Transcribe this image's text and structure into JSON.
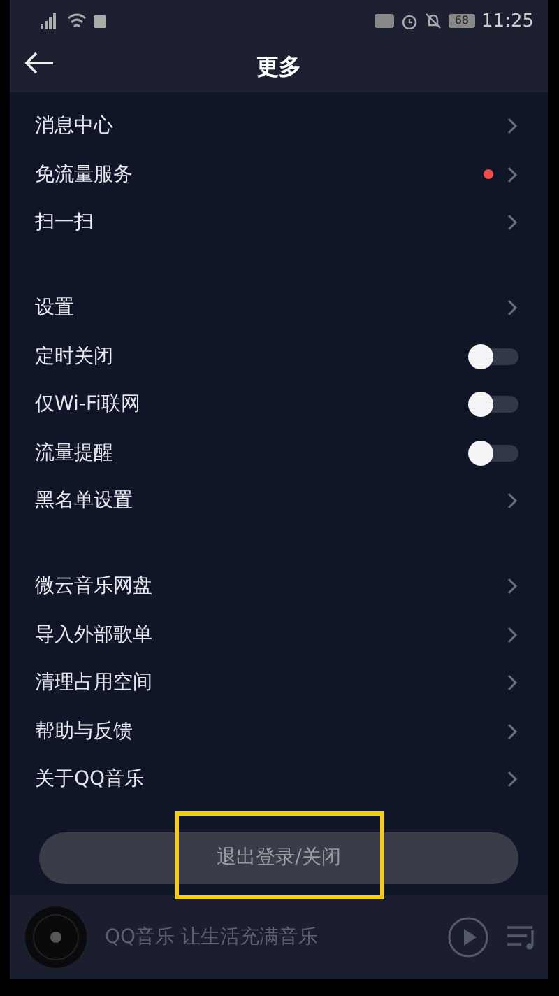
{
  "status_bar": {
    "battery": "68",
    "time": "11:25"
  },
  "header": {
    "title": "更多"
  },
  "groups": [
    {
      "items": [
        {
          "label": "消息中心",
          "kind": "link",
          "badge": false
        },
        {
          "label": "免流量服务",
          "kind": "link",
          "badge": true
        },
        {
          "label": "扫一扫",
          "kind": "link",
          "badge": false
        }
      ]
    },
    {
      "items": [
        {
          "label": "设置",
          "kind": "link",
          "badge": false
        },
        {
          "label": "定时关闭",
          "kind": "toggle",
          "on": false
        },
        {
          "label": "仅Wi-Fi联网",
          "kind": "toggle",
          "on": false
        },
        {
          "label": "流量提醒",
          "kind": "toggle",
          "on": false
        },
        {
          "label": "黑名单设置",
          "kind": "link",
          "badge": false
        }
      ]
    },
    {
      "items": [
        {
          "label": "微云音乐网盘",
          "kind": "link",
          "badge": false
        },
        {
          "label": "导入外部歌单",
          "kind": "link",
          "badge": false
        },
        {
          "label": "清理占用空间",
          "kind": "link",
          "badge": false
        },
        {
          "label": "帮助与反馈",
          "kind": "link",
          "badge": false
        },
        {
          "label": "关于QQ音乐",
          "kind": "link",
          "badge": false
        }
      ]
    }
  ],
  "logout_button": {
    "label": "退出登录/关闭",
    "highlighted": true
  },
  "player": {
    "text": "QQ音乐 让生活充满音乐"
  }
}
